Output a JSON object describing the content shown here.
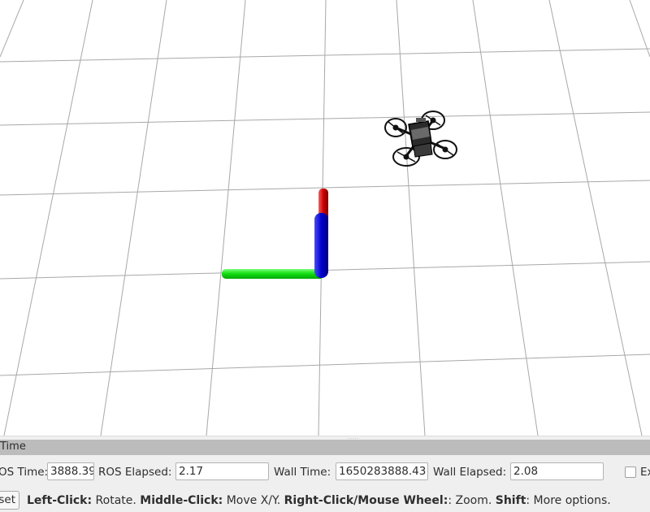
{
  "panel": {
    "title": "Time",
    "ros_time_label": "OS Time:",
    "ros_time_value": "3888.39",
    "ros_elapsed_label": "ROS Elapsed:",
    "ros_elapsed_value": "2.17",
    "wall_time_label": "Wall Time:",
    "wall_time_value": "1650283888.43",
    "wall_elapsed_label": "Wall Elapsed:",
    "wall_elapsed_value": "2.08",
    "experimental_label": "Ex",
    "reset_label": "set"
  },
  "help": {
    "left_click": "Left-Click:",
    "left_click_action": " Rotate. ",
    "middle_click": "Middle-Click:",
    "middle_click_action": " Move X/Y. ",
    "right_click": "Right-Click/Mouse Wheel:",
    "right_click_action": ": Zoom. ",
    "shift": "Shift",
    "shift_action": ": More options."
  },
  "colors": {
    "grid": "#a0a0a0",
    "axis_x": "#cc0000",
    "axis_y": "#00dd00",
    "axis_z": "#0000cc",
    "panel_header": "#bcbcbc"
  },
  "icons": {
    "drone": "quadcopter-model-icon",
    "axes": "coordinate-axes-icon"
  }
}
